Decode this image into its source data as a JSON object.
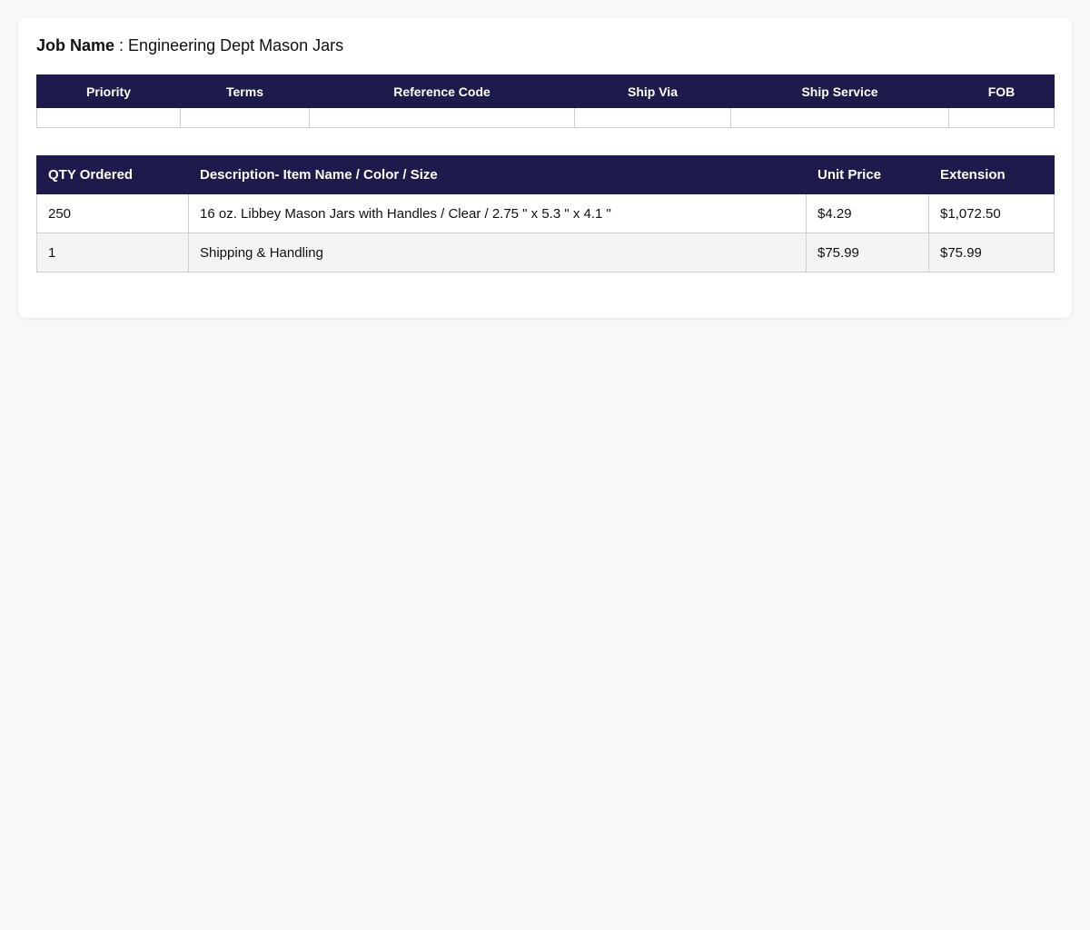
{
  "job": {
    "label": "Job Name",
    "separator": " : ",
    "value": "Engineering Dept Mason Jars"
  },
  "order_info": {
    "headers": [
      "Priority",
      "Terms",
      "Reference Code",
      "Ship Via",
      "Ship Service",
      "FOB"
    ],
    "values": [
      "",
      "",
      "",
      "",
      "",
      ""
    ]
  },
  "line_items": {
    "headers": [
      "QTY Ordered",
      "Description- Item Name / Color / Size",
      "Unit Price",
      "Extension"
    ],
    "rows": [
      [
        "250",
        "16 oz. Libbey Mason Jars with Handles / Clear / 2.75 \" x 5.3 \" x 4.1 \"",
        "$4.29",
        "$1,072.50"
      ],
      [
        "1",
        "Shipping & Handling",
        "$75.99",
        "$75.99"
      ]
    ]
  },
  "colors": {
    "header_bg": "#1c1b4b",
    "header_text": "#ffffff",
    "page_bg": "#f8f8f8",
    "alt_row_bg": "#f4f4f4"
  }
}
